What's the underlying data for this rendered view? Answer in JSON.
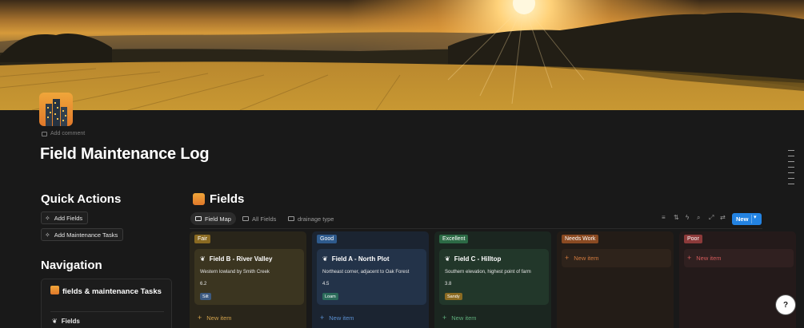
{
  "page": {
    "title": "Field Maintenance Log",
    "add_comment": "Add comment"
  },
  "quick_actions": {
    "title": "Quick Actions",
    "buttons": [
      "Add Fields",
      "Add Maintenance Tasks"
    ]
  },
  "navigation": {
    "title": "Navigation",
    "group_title": "fields & maintenance Tasks",
    "items": [
      "Fields"
    ]
  },
  "database": {
    "title": "Fields",
    "views": [
      "Field Map",
      "All Fields",
      "drainage type"
    ],
    "active_view": "Field Map",
    "new_button": "New",
    "toolbar_icons": [
      "filter-icon",
      "sort-icon",
      "automation-icon",
      "search-icon",
      "expand-icon",
      "settings-icon"
    ]
  },
  "board": {
    "columns": [
      {
        "status": "Fair",
        "status_color": "#8a6a22",
        "column_bg": "#29251a",
        "card_bg": "#3b3520",
        "cards": [
          {
            "name": "Field B - River Valley",
            "description": "Western lowland by Smith Creek",
            "value": "6.2",
            "soil": "Silt",
            "soil_color": "#3d5a80"
          }
        ],
        "new_item": "New item",
        "new_item_color": "#d2a24c"
      },
      {
        "status": "Good",
        "status_color": "#2e5a8c",
        "column_bg": "#1b2431",
        "card_bg": "#233349",
        "cards": [
          {
            "name": "Field A - North Plot",
            "description": "Northeast corner, adjacent to Oak Forest",
            "value": "4.5",
            "soil": "Loam",
            "soil_color": "#2b6a5a"
          }
        ],
        "new_item": "New item",
        "new_item_color": "#5a8fd0"
      },
      {
        "status": "Excellent",
        "status_color": "#2c6a45",
        "column_bg": "#1b2620",
        "card_bg": "#22372a",
        "cards": [
          {
            "name": "Field C - Hilltop",
            "description": "Southern elevation, highest point of farm",
            "value": "3.8",
            "soil": "Sandy",
            "soil_color": "#8a6a22"
          }
        ],
        "new_item": "New item",
        "new_item_color": "#5fae7c"
      },
      {
        "status": "Needs Work",
        "status_color": "#8a4a22",
        "column_bg": "#231c17",
        "card_bg": "#2e231b",
        "cards": [],
        "new_item": "New item",
        "new_item_color": "#d27a3e"
      },
      {
        "status": "Poor",
        "status_color": "#8c3a3a",
        "column_bg": "#241a1a",
        "card_bg": "#302020",
        "cards": [],
        "new_item": "New item",
        "new_item_color": "#d25a5a"
      }
    ]
  },
  "help": {
    "label": "?"
  }
}
